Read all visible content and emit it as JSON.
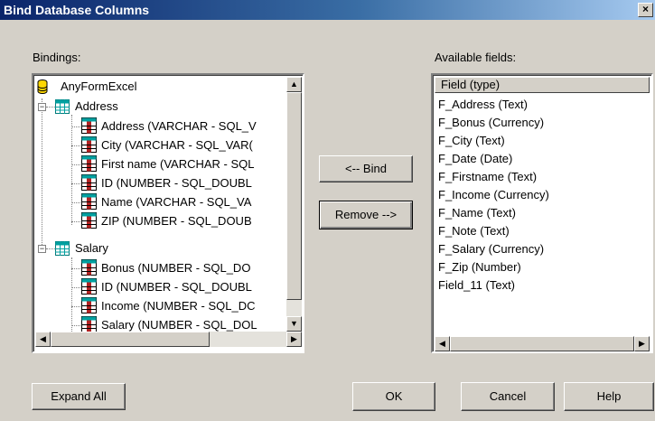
{
  "window": {
    "title": "Bind Database Columns",
    "close_glyph": "×"
  },
  "bindings": {
    "label": "Bindings:",
    "root": {
      "label": "AnyFormExcel",
      "icon": "database-icon"
    },
    "tables": [
      {
        "label": "Address",
        "expander": "−",
        "icon": "table-icon",
        "fields": [
          "Address (VARCHAR - SQL_V",
          "City (VARCHAR - SQL_VAR(",
          "First name (VARCHAR - SQL",
          "ID (NUMBER - SQL_DOUBL",
          "Name (VARCHAR - SQL_VA",
          "ZIP (NUMBER - SQL_DOUB"
        ]
      },
      {
        "label": "Salary",
        "expander": "−",
        "icon": "table-icon",
        "fields": [
          "Bonus (NUMBER - SQL_DO",
          "ID (NUMBER - SQL_DOUBL",
          "Income (NUMBER - SQL_DC",
          "Salary (NUMBER - SQL_DOL"
        ]
      }
    ]
  },
  "buttons": {
    "bind": "<-- Bind",
    "remove": "Remove -->",
    "expand_all": "Expand All",
    "ok": "OK",
    "cancel": "Cancel",
    "help": "Help"
  },
  "available": {
    "label": "Available fields:",
    "column_header": "Field (type)",
    "items": [
      "F_Address (Text)",
      "F_Bonus (Currency)",
      "F_City (Text)",
      "F_Date (Date)",
      "F_Firstname (Text)",
      "F_Income (Currency)",
      "F_Name (Text)",
      "F_Note (Text)",
      "F_Salary (Currency)",
      "F_Zip (Number)",
      "Field_11 (Text)"
    ]
  },
  "scroll": {
    "up_glyph": "▲",
    "down_glyph": "▼",
    "left_glyph": "◀",
    "right_glyph": "▶"
  },
  "colors": {
    "title_gradient_start": "#0a246a",
    "title_gradient_end": "#a6caf0",
    "dialog_bg": "#d4d0c8",
    "db_icon": "#ffd700",
    "table_icon": "#00a0a0",
    "field_icon": "#b22222"
  }
}
